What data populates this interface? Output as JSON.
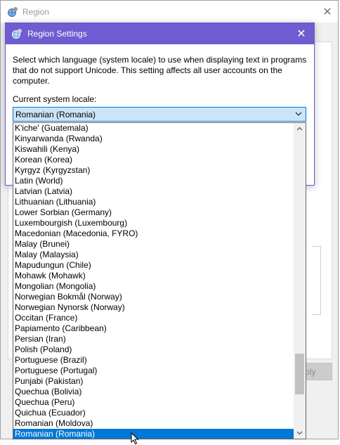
{
  "region_window": {
    "title": "Region",
    "apply_label": "Apply"
  },
  "dialog": {
    "title": "Region Settings",
    "description": "Select which language (system locale) to use when displaying text in programs that do not support Unicode. This setting affects all user accounts on the computer.",
    "locale_label": "Current system locale:",
    "selected_locale": "Romanian (Romania)"
  },
  "dropdown": {
    "items": [
      "K'iche' (Guatemala)",
      "Kinyarwanda (Rwanda)",
      "Kiswahili (Kenya)",
      "Korean (Korea)",
      "Kyrgyz (Kyrgyzstan)",
      "Latin (World)",
      "Latvian (Latvia)",
      "Lithuanian (Lithuania)",
      "Lower Sorbian (Germany)",
      "Luxembourgish (Luxembourg)",
      "Macedonian (Macedonia, FYRO)",
      "Malay (Brunei)",
      "Malay (Malaysia)",
      "Mapudungun (Chile)",
      "Mohawk (Mohawk)",
      "Mongolian (Mongolia)",
      "Norwegian Bokmål (Norway)",
      "Norwegian Nynorsk (Norway)",
      "Occitan (France)",
      "Papiamento (Caribbean)",
      "Persian (Iran)",
      "Polish (Poland)",
      "Portuguese (Brazil)",
      "Portuguese (Portugal)",
      "Punjabi (Pakistan)",
      "Quechua (Bolivia)",
      "Quechua (Peru)",
      "Quichua (Ecuador)",
      "Romanian (Moldova)",
      "Romanian (Romania)"
    ],
    "selected_index": 29,
    "scroll_position": 0.87
  },
  "colors": {
    "dialog_titlebar": "#6e5cd0",
    "selection": "#0078d7",
    "combo_background": "#cce4f7"
  },
  "icons": {
    "app": "globe-settings-icon",
    "close": "close-icon",
    "combo_arrow": "chevron-down-icon",
    "scroll_up": "chevron-up-icon",
    "scroll_down": "chevron-down-icon",
    "cursor": "mouse-pointer-icon"
  }
}
